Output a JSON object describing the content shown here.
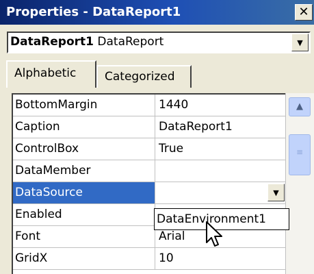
{
  "window": {
    "title": "Properties - DataReport1",
    "close_glyph": "✕"
  },
  "object_selector": {
    "name": "DataReport1",
    "type": "DataReport"
  },
  "tabs": [
    {
      "label": "Alphabetic",
      "active": true
    },
    {
      "label": "Categorized",
      "active": false
    }
  ],
  "properties": [
    {
      "name": "BottomMargin",
      "value": "1440"
    },
    {
      "name": "Caption",
      "value": "DataReport1"
    },
    {
      "name": "ControlBox",
      "value": "True"
    },
    {
      "name": "DataMember",
      "value": ""
    },
    {
      "name": "DataSource",
      "value": "",
      "selected": true
    },
    {
      "name": "Enabled",
      "value": ""
    },
    {
      "name": "Font",
      "value": "Arial"
    },
    {
      "name": "GridX",
      "value": "10"
    }
  ],
  "dropdown": {
    "options": [
      "DataEnvironment1"
    ]
  },
  "colors": {
    "titlebar": "#0a246a",
    "selection": "#316ac5",
    "scroll_thumb": "#c1d3fb"
  },
  "icons": {
    "dropdown": "chevron-down-icon",
    "scroll_up": "chevron-up-icon",
    "cursor": "mouse-pointer-icon"
  }
}
